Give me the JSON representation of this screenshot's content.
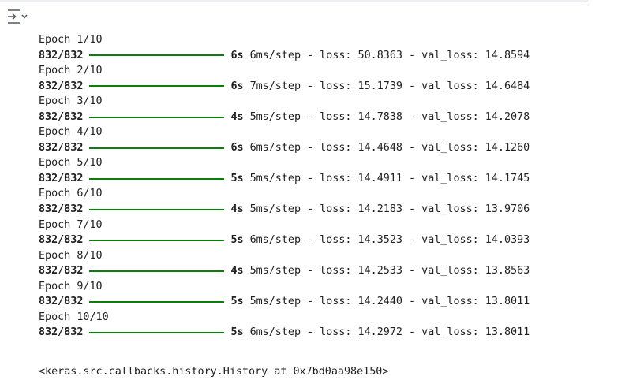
{
  "output": {
    "epochs": [
      {
        "epoch": "Epoch 1/10",
        "steps": "832/832",
        "time": "6s",
        "per_step": "6ms/step",
        "loss_text": "- loss: 50.8363 - val_loss: 14.8594"
      },
      {
        "epoch": "Epoch 2/10",
        "steps": "832/832",
        "time": "6s",
        "per_step": "7ms/step",
        "loss_text": "- loss: 15.1739 - val_loss: 14.6484"
      },
      {
        "epoch": "Epoch 3/10",
        "steps": "832/832",
        "time": "4s",
        "per_step": "5ms/step",
        "loss_text": "- loss: 14.7838 - val_loss: 14.2078"
      },
      {
        "epoch": "Epoch 4/10",
        "steps": "832/832",
        "time": "6s",
        "per_step": "6ms/step",
        "loss_text": "- loss: 14.4648 - val_loss: 14.1260"
      },
      {
        "epoch": "Epoch 5/10",
        "steps": "832/832",
        "time": "5s",
        "per_step": "5ms/step",
        "loss_text": "- loss: 14.4911 - val_loss: 14.1745"
      },
      {
        "epoch": "Epoch 6/10",
        "steps": "832/832",
        "time": "4s",
        "per_step": "5ms/step",
        "loss_text": "- loss: 14.2183 - val_loss: 13.9706"
      },
      {
        "epoch": "Epoch 7/10",
        "steps": "832/832",
        "time": "5s",
        "per_step": "6ms/step",
        "loss_text": "- loss: 14.3523 - val_loss: 14.0393"
      },
      {
        "epoch": "Epoch 8/10",
        "steps": "832/832",
        "time": "4s",
        "per_step": "5ms/step",
        "loss_text": "- loss: 14.2533 - val_loss: 13.8563"
      },
      {
        "epoch": "Epoch 9/10",
        "steps": "832/832",
        "time": "5s",
        "per_step": "5ms/step",
        "loss_text": "- loss: 14.2440 - val_loss: 13.8011"
      },
      {
        "epoch": "Epoch 10/10",
        "steps": "832/832",
        "time": "5s",
        "per_step": "6ms/step",
        "loss_text": "- loss: 14.2972 - val_loss: 13.8011"
      }
    ],
    "result_repr": "<keras.src.callbacks.history.History at 0x7bd0aa98e150>"
  },
  "colors": {
    "progress_bar": "#0a7f0a",
    "text": "#212121"
  },
  "icons": {
    "gutter": "output-actions-icon"
  }
}
